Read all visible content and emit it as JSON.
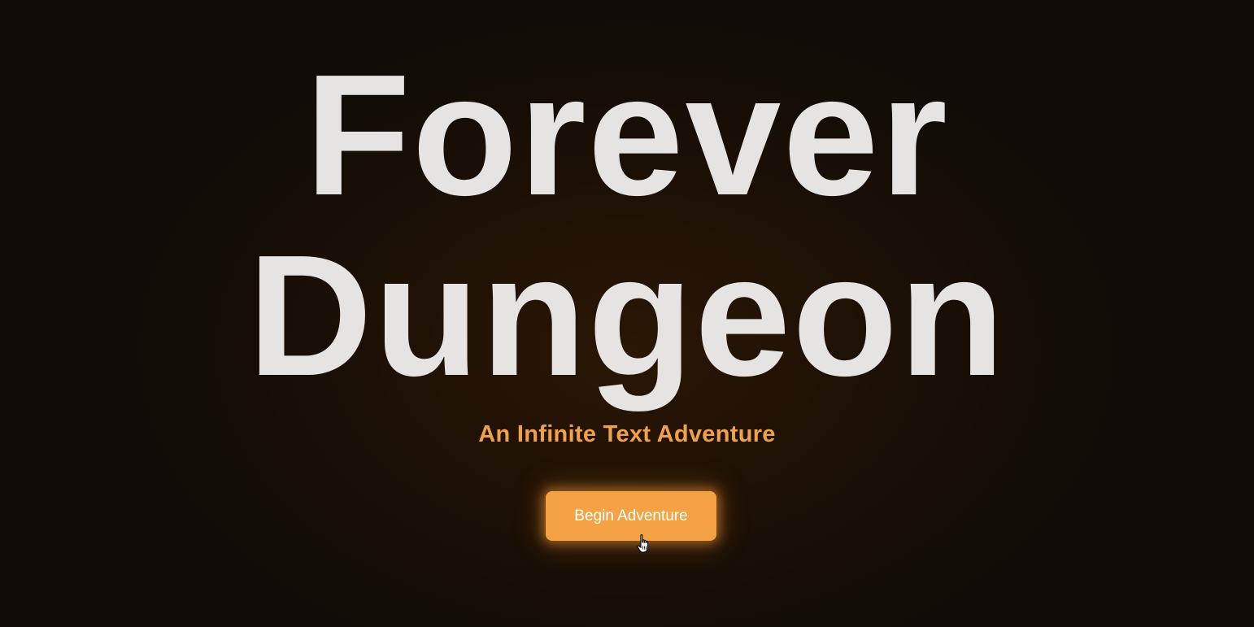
{
  "hero": {
    "title_line_1": "Forever",
    "title_line_2": "Dungeon",
    "subtitle": "An Infinite Text Adventure"
  },
  "actions": {
    "begin_label": "Begin Adventure"
  },
  "colors": {
    "background": "#130d07",
    "title": "#e6e3e3",
    "accent": "#f4a243",
    "subtitle": "#f0a14a",
    "button_text": "#ffffff"
  },
  "icons": {
    "cursor": "hand-pointer-icon"
  }
}
